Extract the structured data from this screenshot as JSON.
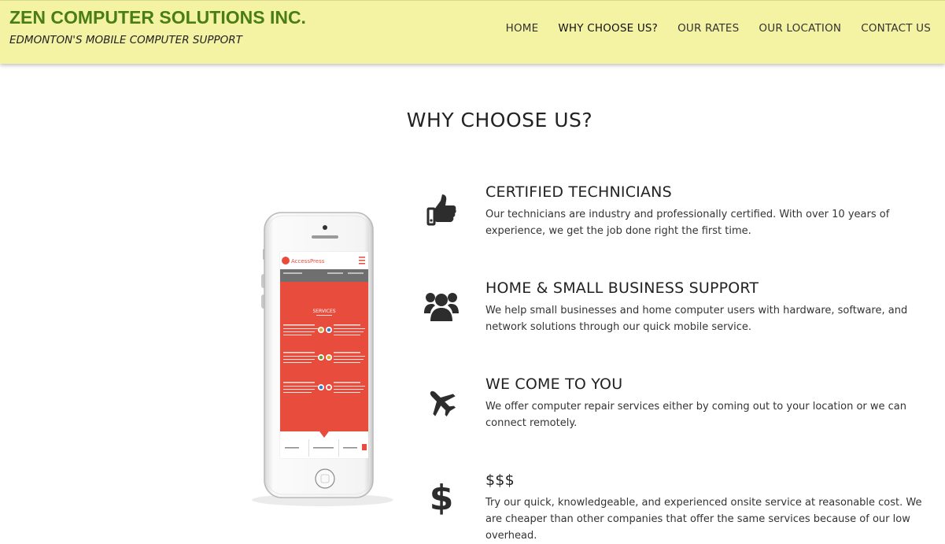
{
  "header": {
    "brand_title": "ZEN COMPUTER SOLUTIONS INC.",
    "tagline": "EDMONTON'S MOBILE COMPUTER SUPPORT",
    "nav": [
      {
        "label": "HOME"
      },
      {
        "label": "WHY CHOOSE US?"
      },
      {
        "label": "OUR RATES"
      },
      {
        "label": "OUR LOCATION"
      },
      {
        "label": "CONTACT US"
      }
    ],
    "active_nav": "WHY CHOOSE US?"
  },
  "main": {
    "title": "WHY CHOOSE US?",
    "features": [
      {
        "icon": "thumbs-up-icon",
        "title": "CERTIFIED TECHNICIANS",
        "text": "Our technicians are industry and professionally certified. With over 10 years of experience, we get the job done right the first time."
      },
      {
        "icon": "users-icon",
        "title": "HOME & SMALL BUSINESS SUPPORT",
        "text": "We help small businesses and home computer users with hardware, software, and network solutions through our quick mobile service."
      },
      {
        "icon": "plane-icon",
        "title": "WE COME TO YOU",
        "text": "We offer computer repair services either by coming out to your location or we can connect remotely."
      },
      {
        "icon": "dollar-icon",
        "title": "$$$",
        "text": "Try our quick, knowledgeable, and experienced onsite service at reasonable cost. We are cheaper than other companies that offer the same services because of our low overhead."
      }
    ]
  },
  "phone_screen": {
    "logo": "AccessPress",
    "section_label": "SERVICES"
  },
  "colors": {
    "header_bg": "#f4f3a4",
    "brand_green": "#4a7d14",
    "phone_accent": "#e74c3c"
  }
}
